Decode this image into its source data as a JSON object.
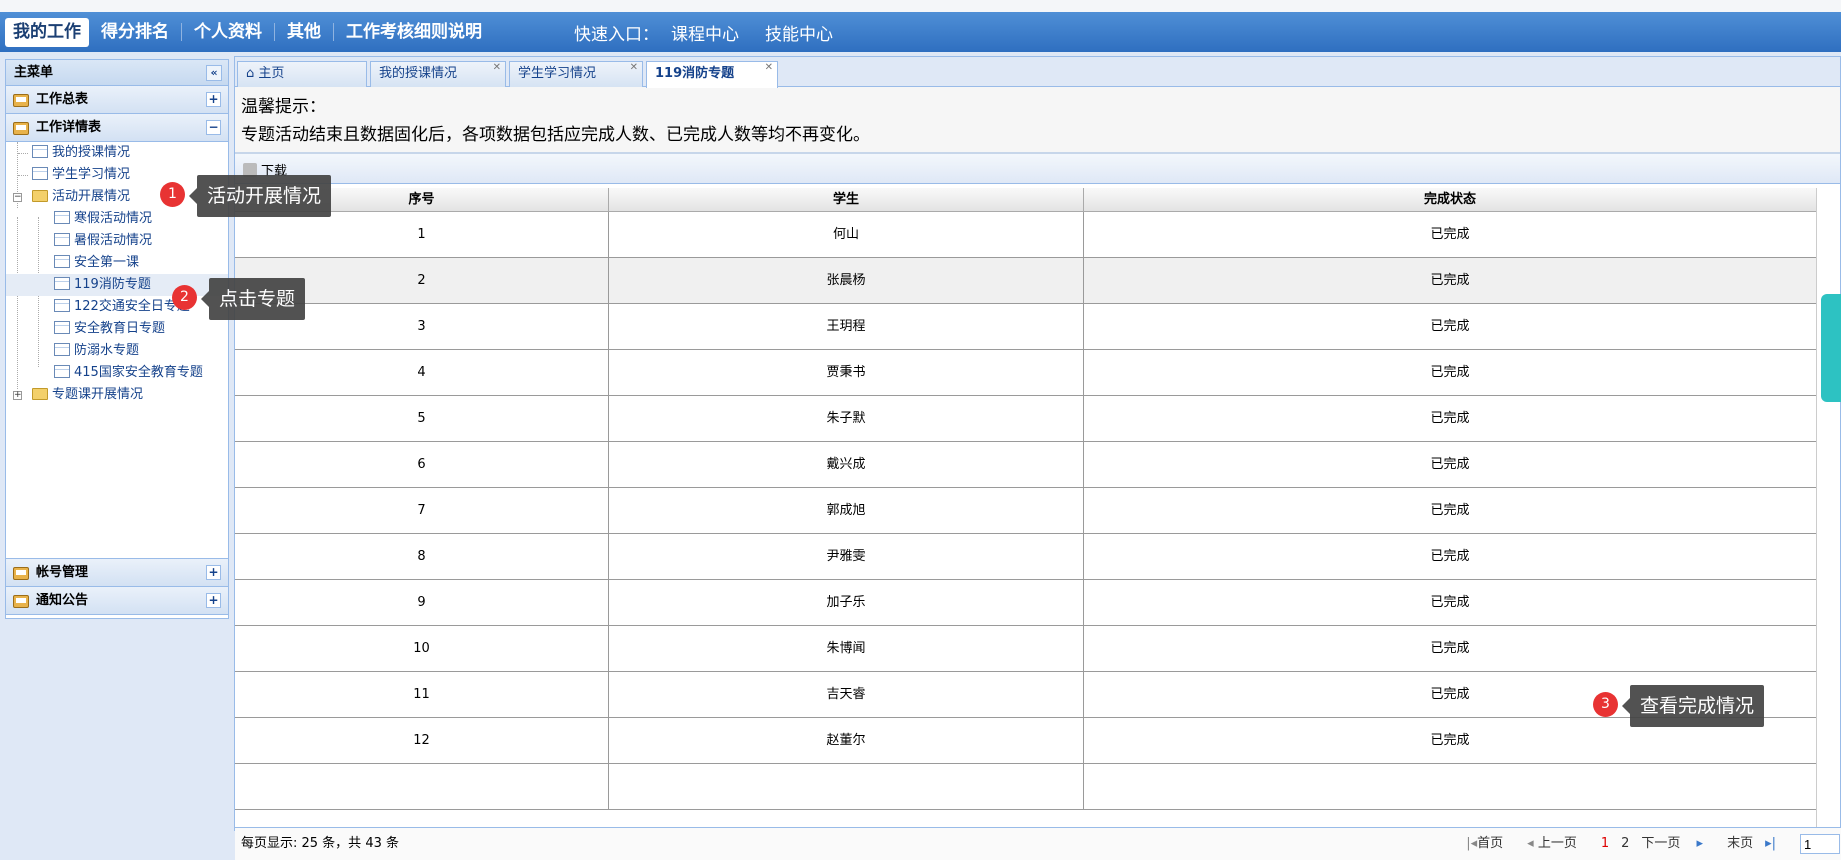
{
  "topnav": {
    "items": [
      "我的工作",
      "得分排名",
      "个人资料",
      "其他",
      "工作考核细则说明"
    ],
    "quick_label": "快速入口：",
    "quick_links": [
      "课程中心",
      "技能中心"
    ]
  },
  "sidebar": {
    "title": "主菜单",
    "collapse_symbol": "«",
    "sections": [
      "工作总表",
      "工作详情表",
      "帐号管理",
      "通知公告"
    ],
    "section_toggles": [
      "+",
      "−",
      "+",
      "+"
    ],
    "tree": {
      "my_teaching": "我的授课情况",
      "student_study": "学生学习情况",
      "activity_folder": "活动开展情况",
      "children": [
        "寒假活动情况",
        "暑假活动情况",
        "安全第一课",
        "119消防专题",
        "122交通安全日专题",
        "安全教育日专题",
        "防溺水专题",
        "415国家安全教育专题"
      ],
      "topic_folder": "专题课开展情况"
    }
  },
  "tabs": [
    {
      "label": "主页",
      "icon": "home-icon"
    },
    {
      "label": "我的授课情况"
    },
    {
      "label": "学生学习情况"
    },
    {
      "label": "119消防专题"
    }
  ],
  "tab_close": "✕",
  "notice": {
    "title": "温馨提示：",
    "text": "专题活动结束且数据固化后，各项数据包括应完成人数、已完成人数等均不再变化。"
  },
  "toolbar": {
    "download_label": "下载"
  },
  "table": {
    "headers": [
      "序号",
      "学生",
      "完成状态"
    ],
    "rows": [
      [
        "1",
        "何山",
        "已完成"
      ],
      [
        "2",
        "张晨杨",
        "已完成"
      ],
      [
        "3",
        "王玥程",
        "已完成"
      ],
      [
        "4",
        "贾秉书",
        "已完成"
      ],
      [
        "5",
        "朱子默",
        "已完成"
      ],
      [
        "6",
        "戴兴成",
        "已完成"
      ],
      [
        "7",
        "郭成旭",
        "已完成"
      ],
      [
        "8",
        "尹雅雯",
        "已完成"
      ],
      [
        "9",
        "加子乐",
        "已完成"
      ],
      [
        "10",
        "朱博闻",
        "已完成"
      ],
      [
        "11",
        "吉天睿",
        "已完成"
      ],
      [
        "12",
        "赵董尔",
        "已完成"
      ]
    ]
  },
  "pager": {
    "info": "每页显示: 25 条，共 43 条",
    "first": "首页",
    "prev": "上一页",
    "pages": [
      "1",
      "2"
    ],
    "next": "下一页",
    "last": "末页",
    "page_input": "1"
  },
  "callouts": [
    {
      "num": "1",
      "text": "活动开展情况"
    },
    {
      "num": "2",
      "text": "点击专题"
    },
    {
      "num": "3",
      "text": "查看完成情况"
    }
  ],
  "colors": {
    "nav": "#2f6fc0",
    "badge": "#e83333",
    "callout": "#444444",
    "widget": "#2dc2c2"
  }
}
